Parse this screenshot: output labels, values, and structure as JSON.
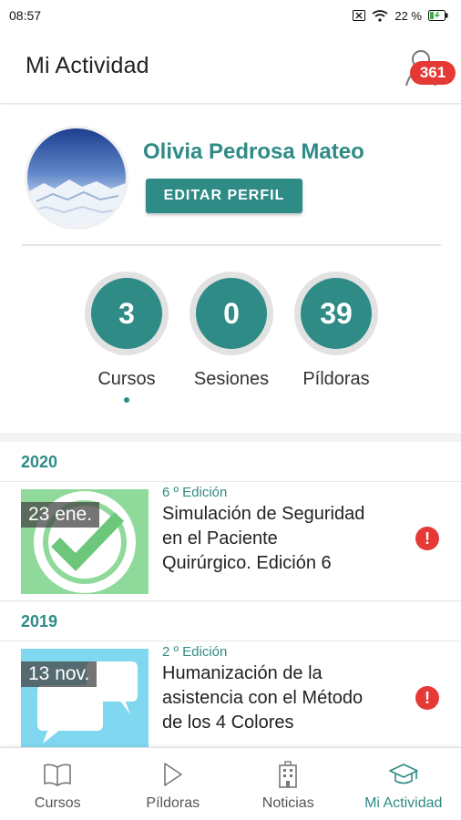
{
  "status_bar": {
    "time": "08:57",
    "battery": "22 %"
  },
  "app_bar": {
    "title": "Mi Actividad",
    "notification_count": "361"
  },
  "profile": {
    "name": "Olivia Pedrosa Mateo",
    "edit_label": "EDITAR PERFIL"
  },
  "stats": [
    {
      "value": "3",
      "label": "Cursos"
    },
    {
      "value": "0",
      "label": "Sesiones"
    },
    {
      "value": "39",
      "label": "Píldoras"
    }
  ],
  "activity": {
    "groups": [
      {
        "year": "2020",
        "items": [
          {
            "date": "23 ene.",
            "edition": "6 º Edición",
            "title": "Simulación de Seguridad en el Paciente Quirúrgico. Edición 6",
            "thumbnail_icon": "checkmark-icon"
          }
        ]
      },
      {
        "year": "2019",
        "items": [
          {
            "date": "13 nov.",
            "edition": "2 º Edición",
            "title": "Humanización de la asistencia con el Método de los 4 Colores",
            "thumbnail_icon": "chat-bubbles-icon"
          }
        ]
      }
    ]
  },
  "bottom_nav": [
    {
      "label": "Cursos",
      "icon": "book-icon"
    },
    {
      "label": "Píldoras",
      "icon": "play-icon"
    },
    {
      "label": "Noticias",
      "icon": "building-icon"
    },
    {
      "label": "Mi Actividad",
      "icon": "graduation-cap-icon",
      "active": true
    }
  ],
  "colors": {
    "primary": "#2e8b86",
    "alert": "#e53935",
    "stat_ring": "#e2e2e2",
    "thumb_green": "#8fd99a",
    "thumb_blue": "#7fd8f0"
  }
}
